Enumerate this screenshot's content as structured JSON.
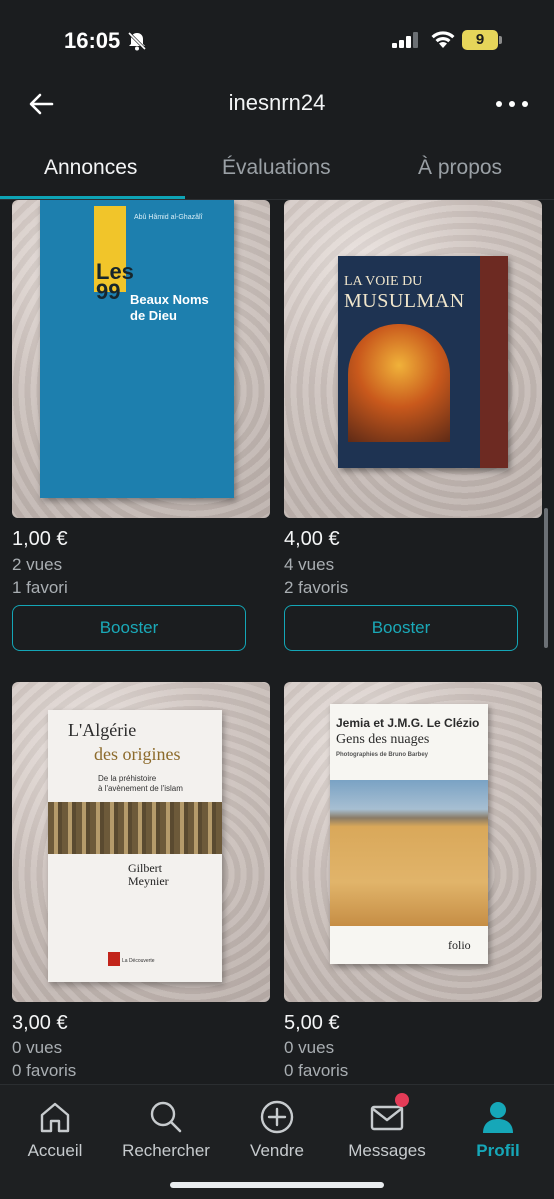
{
  "status_bar": {
    "time": "16:05",
    "battery": "9"
  },
  "header": {
    "title": "inesnrn24"
  },
  "tabs": [
    {
      "label": "Annonces",
      "active": true
    },
    {
      "label": "Évaluations",
      "active": false
    },
    {
      "label": "À propos",
      "active": false
    }
  ],
  "listings": [
    {
      "price": "1,00 €",
      "views": "2 vues",
      "favorites": "1 favori",
      "button": "Booster",
      "cover": {
        "author": "Abû Hâmid al-Ghazâlî",
        "badge_line1": "Les",
        "badge_line2": "99",
        "title_line1": "Beaux Noms",
        "title_line2": "de Dieu"
      }
    },
    {
      "price": "4,00 €",
      "views": "4 vues",
      "favorites": "2 favoris",
      "button": "Booster",
      "cover": {
        "title_line1": "LA VOIE DU",
        "title_line2": "MUSULMAN"
      }
    },
    {
      "price": "3,00 €",
      "views": "0 vues",
      "favorites": "0 favoris",
      "cover": {
        "title_line1": "L'Algérie",
        "title_line2": "des origines",
        "subtitle_line1": "De la préhistoire",
        "subtitle_line2": "à l'avènement de l'islam",
        "author_line1": "Gilbert",
        "author_line2": "Meynier",
        "publisher": "La Découverte"
      }
    },
    {
      "price": "5,00 €",
      "views": "0 vues",
      "favorites": "0 favoris",
      "cover": {
        "author": "Jemia et J.M.G. Le Clézio",
        "title": "Gens des nuages",
        "photo_credit": "Photographies de Bruno Barbey",
        "publisher": "folio"
      }
    }
  ],
  "bottom_nav": [
    {
      "label": "Accueil",
      "icon": "home-icon",
      "active": false
    },
    {
      "label": "Rechercher",
      "icon": "search-icon",
      "active": false
    },
    {
      "label": "Vendre",
      "icon": "plus-circle-icon",
      "active": false
    },
    {
      "label": "Messages",
      "icon": "mail-icon",
      "active": false,
      "has_badge": true
    },
    {
      "label": "Profil",
      "icon": "profile-icon",
      "active": true
    }
  ],
  "colors": {
    "accent": "#14a6b6",
    "background": "#1b1d1f",
    "badge": "#e33b57"
  }
}
